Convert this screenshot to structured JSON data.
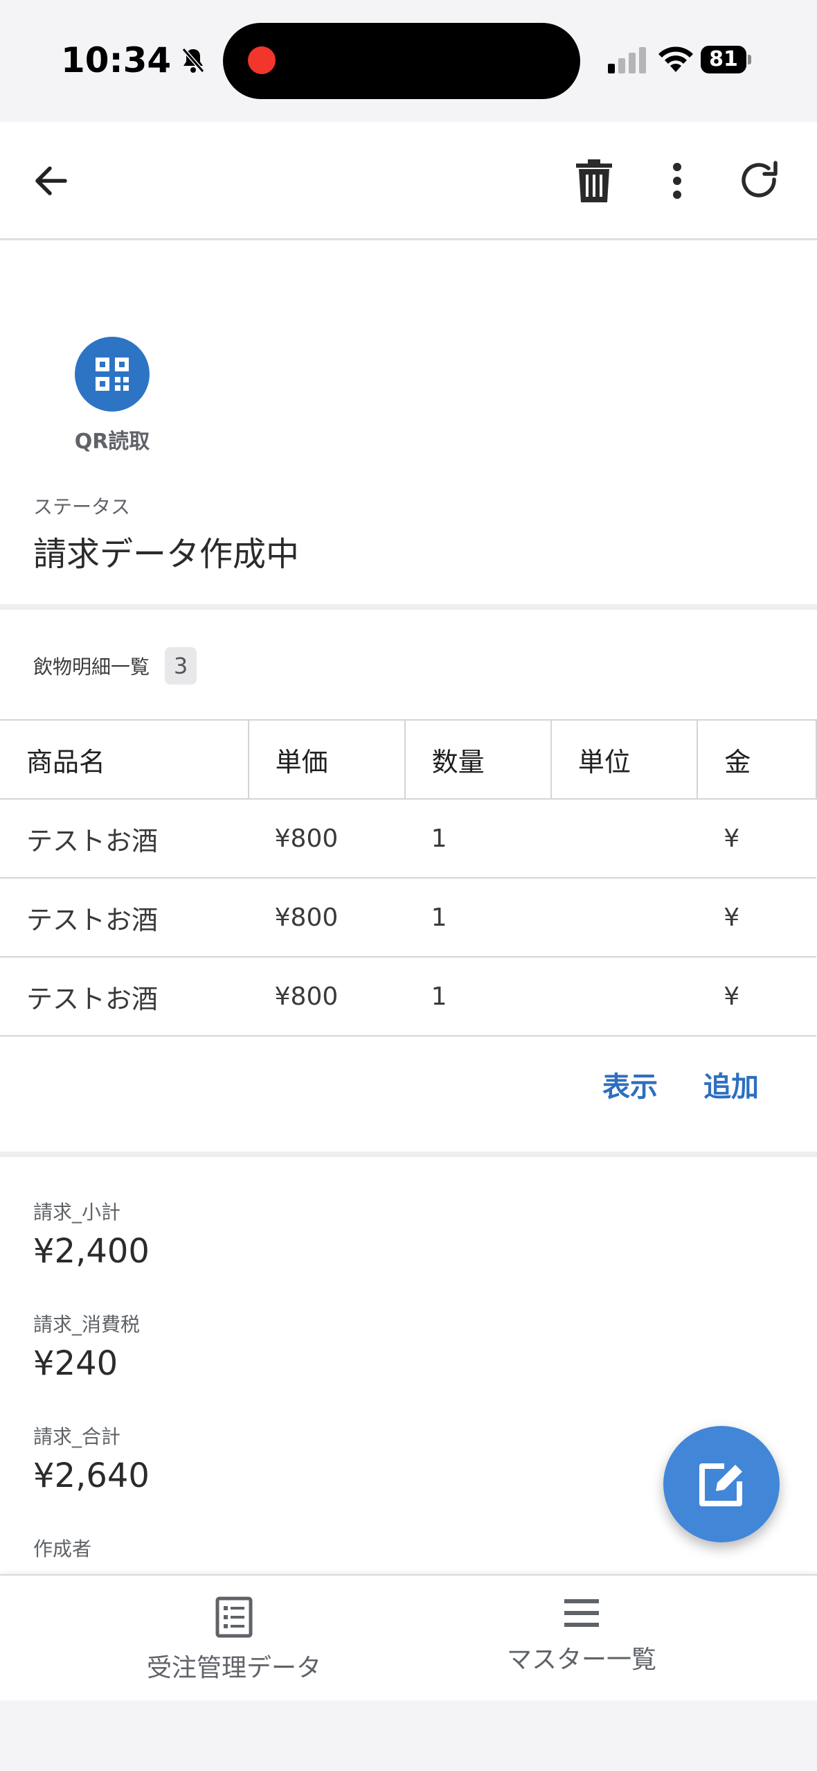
{
  "status_bar": {
    "time": "10:34",
    "battery": "81"
  },
  "qr_button": {
    "label": "QR読取"
  },
  "status_field": {
    "label": "ステータス",
    "value": "請求データ作成中"
  },
  "items_section": {
    "title": "飲物明細一覧",
    "count": "3",
    "columns": [
      "商品名",
      "単価",
      "数量",
      "単位",
      "金"
    ],
    "rows": [
      {
        "name": "テストお酒",
        "price": "¥800",
        "qty": "1",
        "unit": "",
        "amount": "¥"
      },
      {
        "name": "テストお酒",
        "price": "¥800",
        "qty": "1",
        "unit": "",
        "amount": "¥"
      },
      {
        "name": "テストお酒",
        "price": "¥800",
        "qty": "1",
        "unit": "",
        "amount": "¥"
      }
    ],
    "actions": {
      "view": "表示",
      "add": "追加"
    }
  },
  "summary": {
    "subtotal": {
      "label": "請求_小計",
      "value": "¥2,400"
    },
    "tax": {
      "label": "請求_消費税",
      "value": "¥240"
    },
    "total": {
      "label": "請求_合計",
      "value": "¥2,640"
    },
    "creator": {
      "label": "作成者"
    }
  },
  "bottom_nav": {
    "orders": "受注管理データ",
    "master": "マスター一覧"
  },
  "colors": {
    "accent": "#2d74c4",
    "fab": "#4286d8",
    "link": "#2d6fc0",
    "recording": "#f2362b"
  }
}
